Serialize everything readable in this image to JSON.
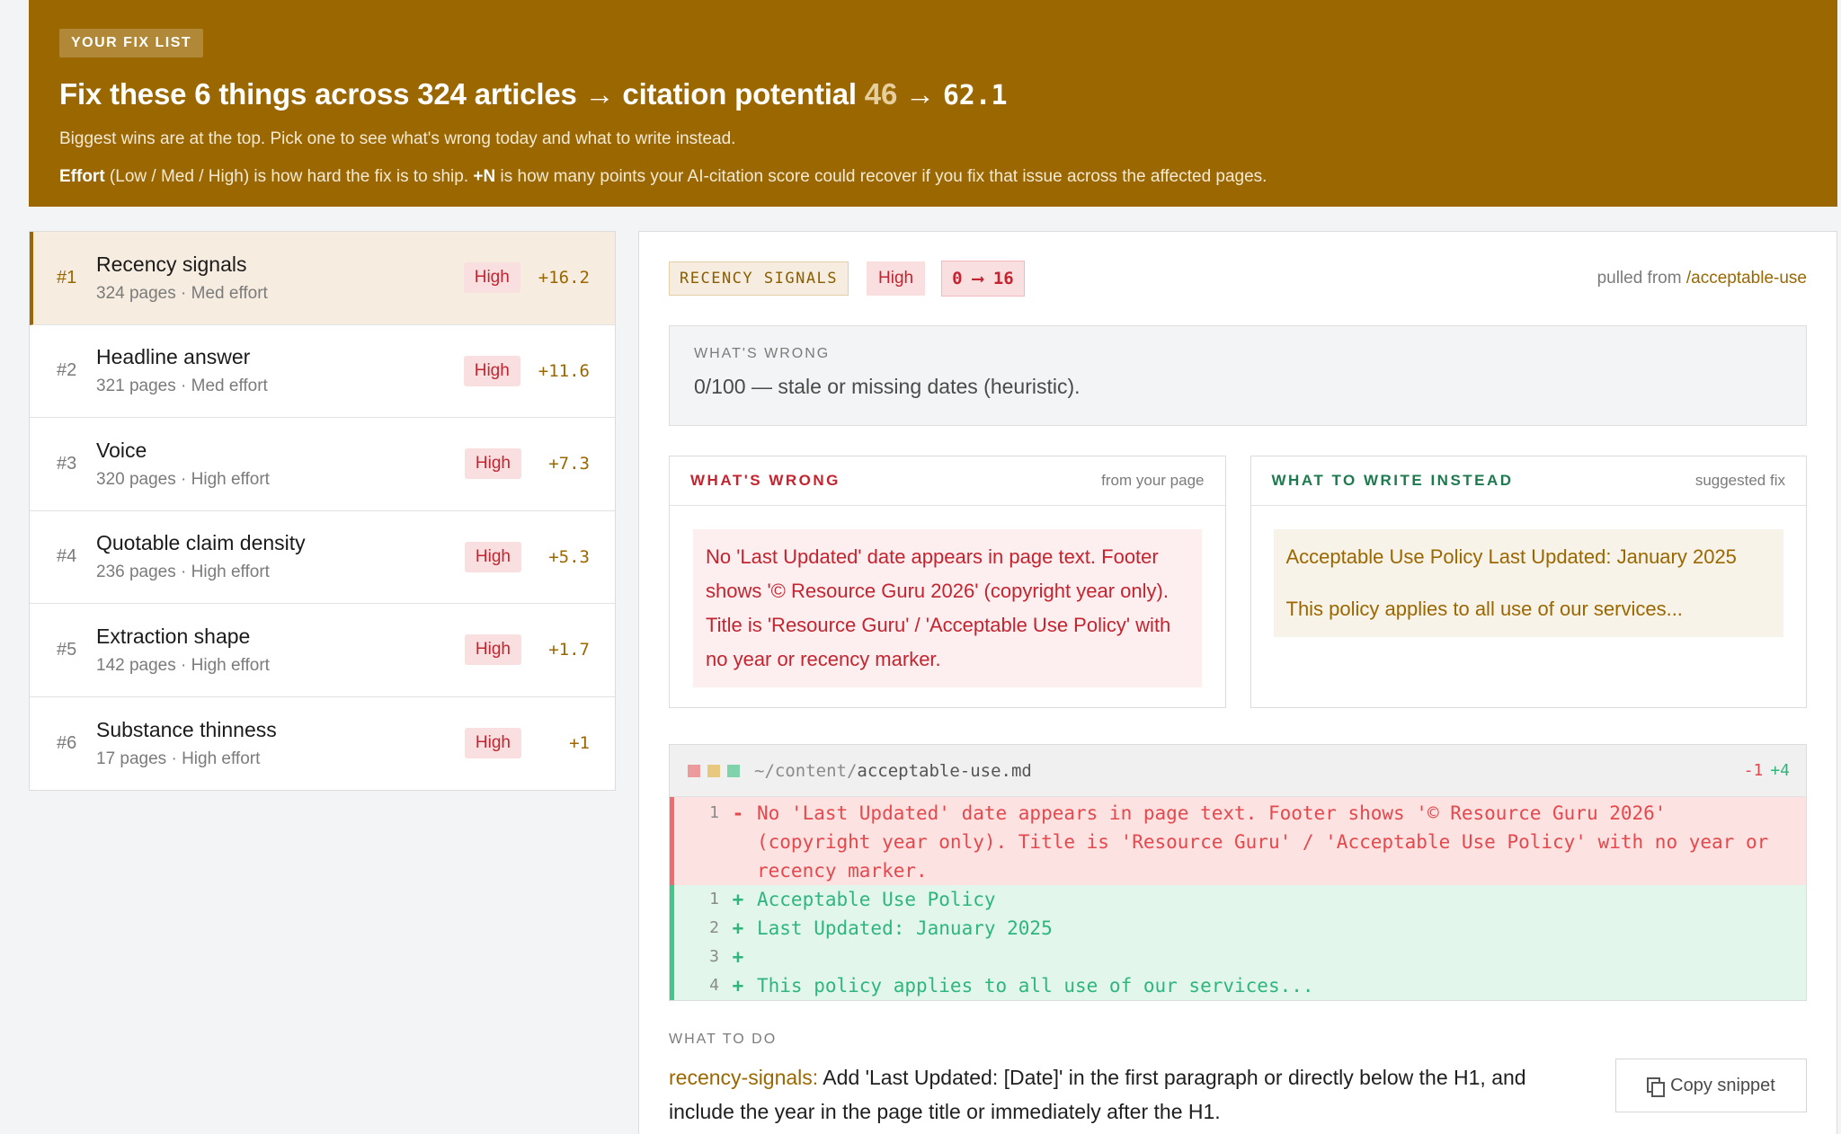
{
  "banner": {
    "tag": "YOUR FIX LIST",
    "title_prefix": "Fix these 6 things across 324 articles → citation potential ",
    "score_from": "46",
    "arrow": " → ",
    "score_to": "62.1",
    "subtitle": "Biggest wins are at the top. Pick one to see what's wrong today and what to write instead.",
    "legend_effort_label": "Effort",
    "legend_effort_text": " (Low / Med / High) is how hard the fix is to ship. ",
    "legend_points_label": "+N",
    "legend_points_text": " is how many points your AI-citation score could recover if you fix that issue across the affected pages."
  },
  "fixes": [
    {
      "rank": "#1",
      "name": "Recency signals",
      "meta": "324 pages · Med effort",
      "impact": "High",
      "points": "+16.2"
    },
    {
      "rank": "#2",
      "name": "Headline answer",
      "meta": "321 pages · Med effort",
      "impact": "High",
      "points": "+11.6"
    },
    {
      "rank": "#3",
      "name": "Voice",
      "meta": "320 pages · High effort",
      "impact": "High",
      "points": "+7.3"
    },
    {
      "rank": "#4",
      "name": "Quotable claim density",
      "meta": "236 pages · High effort",
      "impact": "High",
      "points": "+5.3"
    },
    {
      "rank": "#5",
      "name": "Extraction shape",
      "meta": "142 pages · High effort",
      "impact": "High",
      "points": "+1.7"
    },
    {
      "rank": "#6",
      "name": "Substance thinness",
      "meta": "17 pages · High effort",
      "impact": "High",
      "points": "+1"
    }
  ],
  "detail": {
    "category": "RECENCY SIGNALS",
    "impact": "High",
    "delta": "0 ⟶ 16",
    "pulled_label": "pulled from ",
    "pulled_path": "/acceptable-use",
    "wrong_label": "WHAT'S WRONG",
    "wrong_text": "0/100 — stale or missing dates (heuristic).",
    "card_wrong": {
      "title": "WHAT'S WRONG",
      "note": "from your page",
      "body": "No 'Last Updated' date appears in page text. Footer shows '© Resource Guru 2026' (copyright year only). Title is 'Resource Guru' / 'Acceptable Use Policy' with no year or recency marker."
    },
    "card_write": {
      "title": "WHAT TO WRITE INSTEAD",
      "note": "suggested fix",
      "body_1": "Acceptable Use Policy Last Updated: January 2025",
      "body_2": "This policy applies to all use of our services..."
    },
    "diff": {
      "path_prefix": "~/content/",
      "file": "acceptable-use.md",
      "removed": "-1",
      "added": "+4",
      "lines": [
        {
          "num": "1",
          "sign": "-",
          "text": "No 'Last Updated' date appears in page text. Footer shows '© Resource Guru 2026' (copyright year only). Title is 'Resource Guru' / 'Acceptable Use Policy' with no year or recency marker."
        },
        {
          "num": "1",
          "sign": "+",
          "text": "Acceptable Use Policy"
        },
        {
          "num": "2",
          "sign": "+",
          "text": "Last Updated: January 2025"
        },
        {
          "num": "3",
          "sign": "+",
          "text": ""
        },
        {
          "num": "4",
          "sign": "+",
          "text": "This policy applies to all use of our services..."
        }
      ]
    },
    "todo_label": "WHAT TO DO",
    "todo_key": "recency-signals:",
    "todo_text": " Add 'Last Updated: [Date]' in the first paragraph or directly below the H1, and include the year in the page title or immediately after the H1.",
    "copy_label": "Copy snippet"
  },
  "colors": {
    "accent": "#9a6700",
    "danger": "#c4242f",
    "success": "#1d7a4f"
  }
}
